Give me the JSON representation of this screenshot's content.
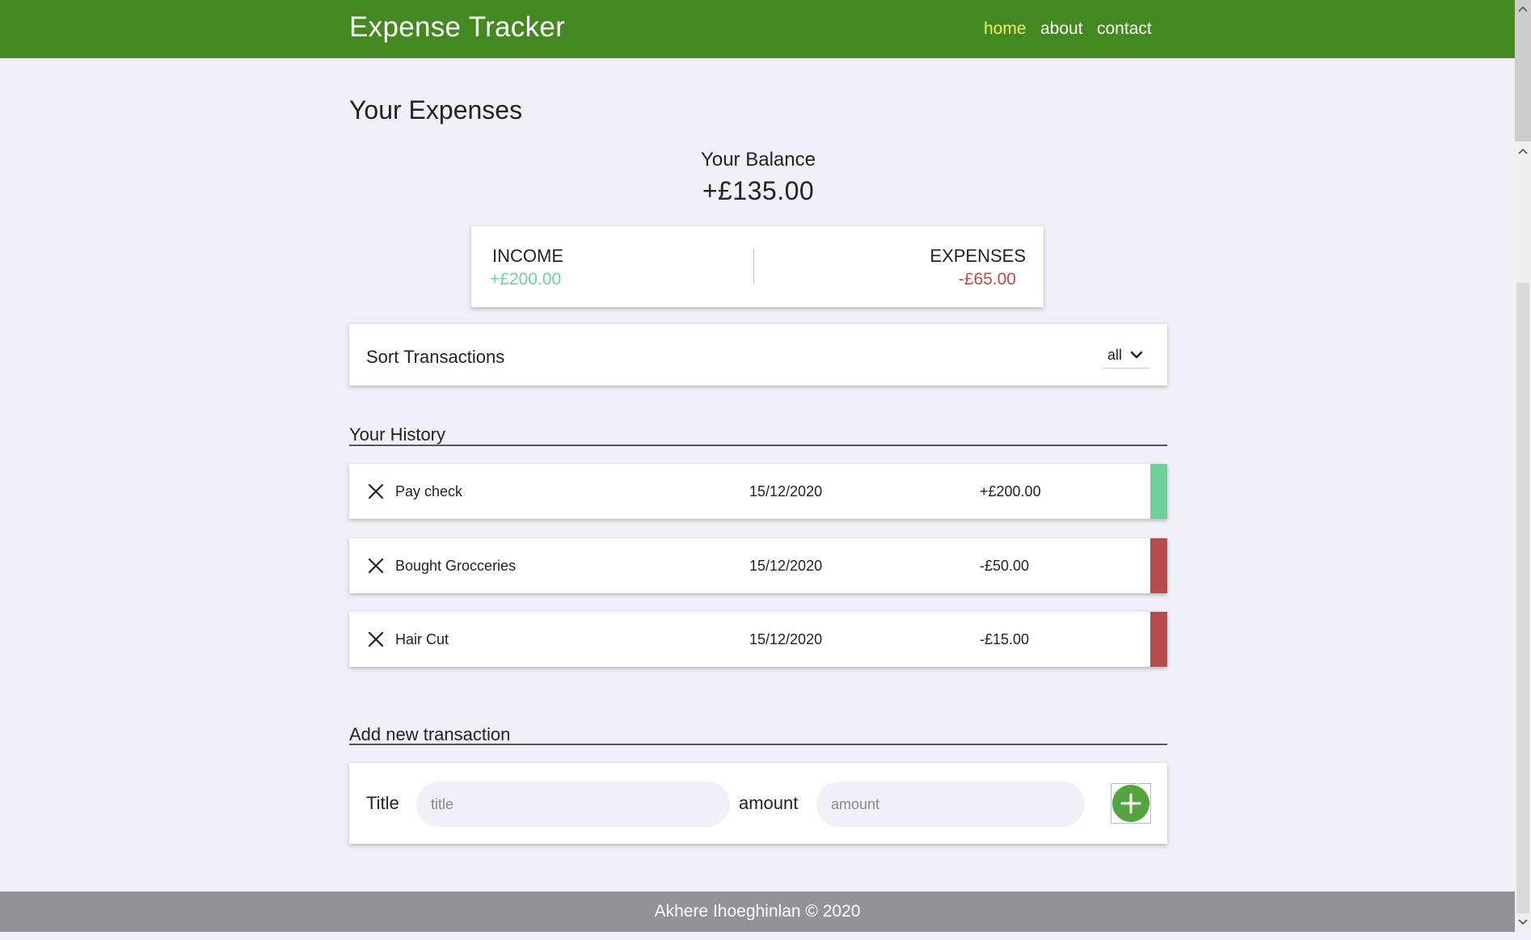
{
  "header": {
    "brand": "Expense Tracker",
    "nav": [
      {
        "label": "home",
        "active": true
      },
      {
        "label": "about",
        "active": false
      },
      {
        "label": "contact",
        "active": false
      }
    ]
  },
  "main": {
    "title": "Your Expenses",
    "balance_label": "Your Balance",
    "balance_value": "+£135.00",
    "income_label": "INCOME",
    "income_value": "+£200.00",
    "expenses_label": "EXPENSES",
    "expenses_value": "-£65.00",
    "sort_label": "Sort Transactions",
    "sort_value": "all",
    "history_title": "Your History",
    "transactions": [
      {
        "title": "Pay check",
        "date": "15/12/2020",
        "amount": "+£200.00",
        "type": "income"
      },
      {
        "title": "Bought Grocceries",
        "date": "15/12/2020",
        "amount": "-£50.00",
        "type": "expense"
      },
      {
        "title": "Hair Cut",
        "date": "15/12/2020",
        "amount": "-£15.00",
        "type": "expense"
      }
    ],
    "add_title": "Add new transaction",
    "form": {
      "title_label": "Title",
      "title_placeholder": "title",
      "amount_label": "amount",
      "amount_placeholder": "amount"
    }
  },
  "footer": {
    "text": "Akhere Ihoeghinlan © 2020"
  },
  "colors": {
    "header": "#438821",
    "income": "#6fd19a",
    "expense": "#b84b4b",
    "add_button": "#53a53f",
    "footer": "#929298"
  },
  "icons": [
    "close-icon",
    "chevron-down-icon",
    "plus-icon"
  ]
}
